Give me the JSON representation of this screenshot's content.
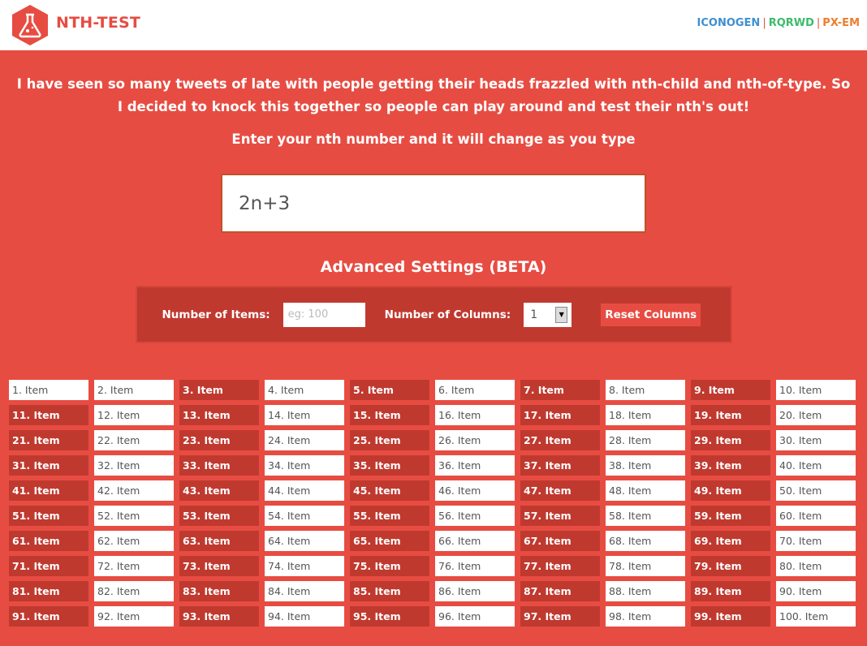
{
  "header": {
    "brand": "NTH-TEST",
    "brand_color": "#e74c42",
    "logo_icon": "flask-hexagon-icon",
    "links": [
      {
        "label": "ICONOGEN",
        "color": "#3d8fd1"
      },
      {
        "label": "RQRWD",
        "color": "#3dbb6a"
      },
      {
        "label": "PX-EM",
        "color": "#ee7d2c"
      }
    ],
    "separator": "|"
  },
  "intro": {
    "text": "I have seen so many tweets of late with people getting their heads frazzled with nth-child and nth-of-type. So I decided to knock this together so people can play around and test their nth's out!",
    "prompt": "Enter your nth number and it will change as you type"
  },
  "nth_input": {
    "value": "2n+3"
  },
  "advanced": {
    "title": "Advanced Settings (BETA)",
    "items_label": "Number of Items:",
    "items_placeholder": "eg: 100",
    "items_value": "",
    "columns_label": "Number of Columns:",
    "columns_value": "1",
    "reset_label": "Reset Columns"
  },
  "items": {
    "count": 100,
    "label_suffix": ". Item",
    "highlighted": [
      3,
      5,
      7,
      9,
      11,
      13,
      15,
      17,
      19,
      21,
      23,
      25,
      27,
      29,
      31,
      33,
      35,
      37,
      39,
      41,
      43,
      45,
      47,
      49,
      51,
      53,
      55,
      57,
      59,
      61,
      63,
      65,
      67,
      69,
      71,
      73,
      75,
      77,
      79,
      81,
      83,
      85,
      87,
      89,
      91,
      93,
      95,
      97,
      99
    ]
  },
  "colors": {
    "background": "#e74c42",
    "highlight": "#c0392f",
    "item_bg": "#ffffff"
  }
}
